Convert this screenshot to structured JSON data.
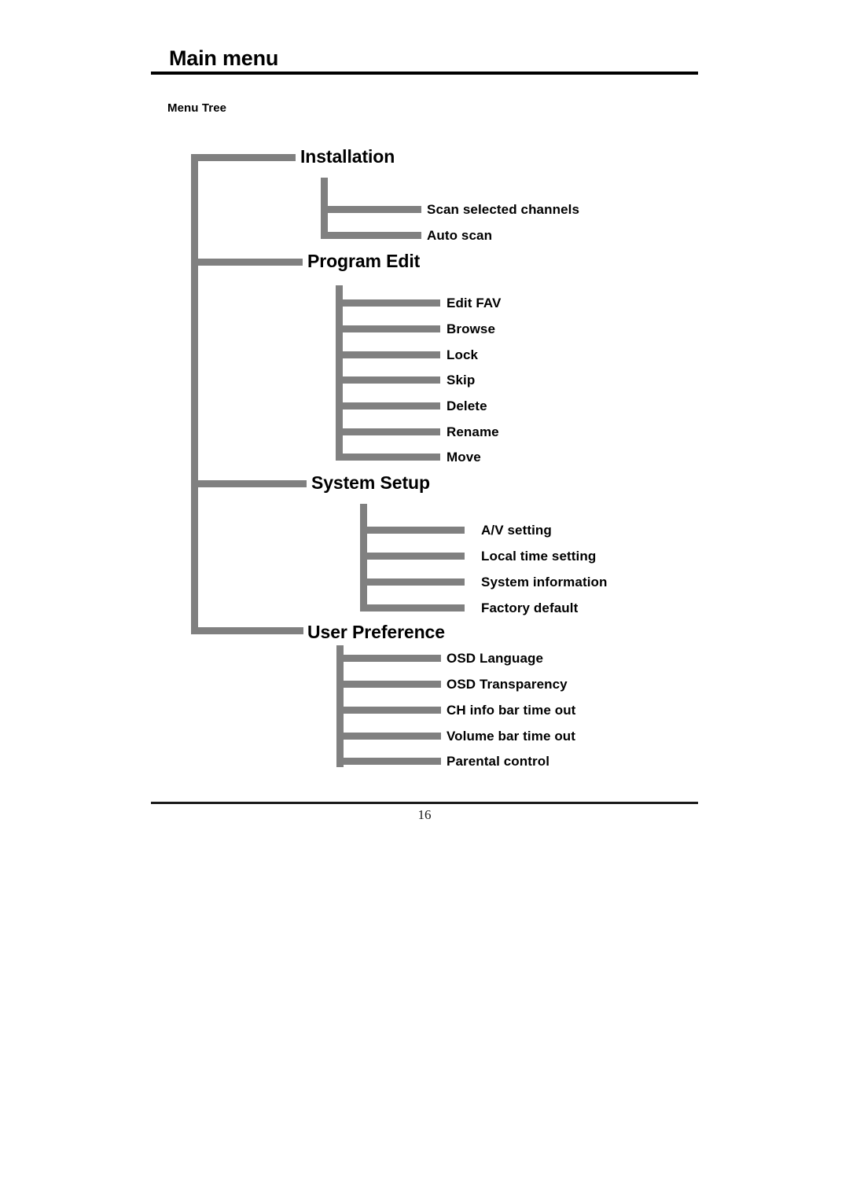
{
  "document": {
    "title": "Main menu",
    "section_label": "Menu Tree",
    "page_number": "16"
  },
  "colors": {
    "tree_line": "#808080",
    "rule": "#000000",
    "text": "#000000",
    "background": "#ffffff"
  },
  "tree": {
    "root_label": "Menu Tree",
    "branches": [
      {
        "label": "Installation",
        "children": [
          {
            "label": "Scan selected channels"
          },
          {
            "label": "Auto scan"
          }
        ]
      },
      {
        "label": "Program Edit",
        "children": [
          {
            "label": "Edit FAV"
          },
          {
            "label": "Browse"
          },
          {
            "label": "Lock"
          },
          {
            "label": "Skip"
          },
          {
            "label": "Delete"
          },
          {
            "label": "Rename"
          },
          {
            "label": "Move"
          }
        ]
      },
      {
        "label": "System Setup",
        "children": [
          {
            "label": "A/V setting"
          },
          {
            "label": "Local time setting"
          },
          {
            "label": "System information"
          },
          {
            "label": "Factory default"
          }
        ]
      },
      {
        "label": "User Preference",
        "children": [
          {
            "label": "OSD Language"
          },
          {
            "label": "OSD Transparency"
          },
          {
            "label": "CH info bar time out"
          },
          {
            "label": "Volume bar time out"
          },
          {
            "label": "Parental control"
          }
        ]
      }
    ]
  }
}
